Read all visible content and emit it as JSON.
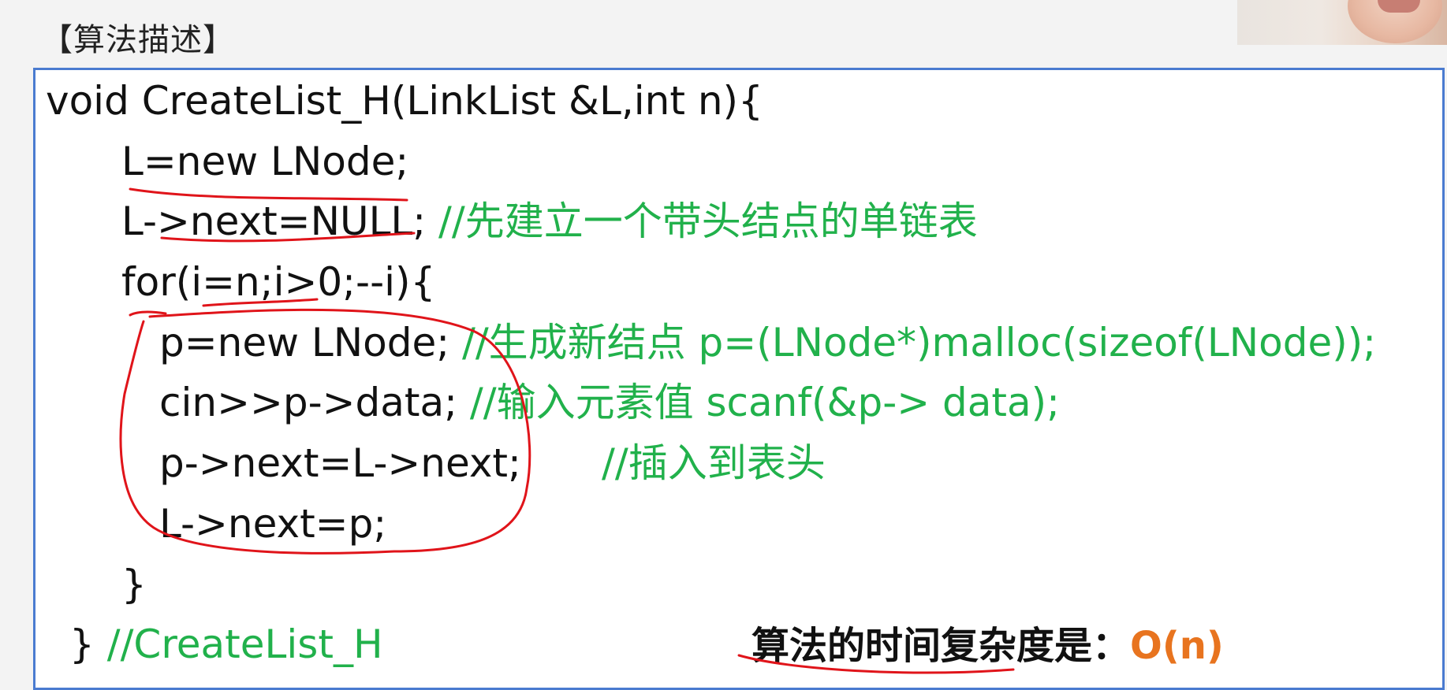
{
  "heading": "【算法描述】",
  "code": {
    "l1": "void CreateList_H(LinkList &L,int n){",
    "l2": "L=new LNode;",
    "l3_code": "L->next=NULL;",
    "l3_comment": " //先建立一个带头结点的单链表",
    "l4": "for(i=n;i>0;--i){",
    "l5_code": "p=new LNode;",
    "l5_comment": " //生成新结点 p=(LNode*)malloc(sizeof(LNode));",
    "l6_code": "cin>>p->data;",
    "l6_comment": " //输入元素值 scanf(&p-> data);",
    "l7_code": "p->next=L->next;",
    "l7_comment": "//插入到表头",
    "l8": "L->next=p;",
    "l9": "}",
    "l10_code": "} ",
    "l10_comment": "//CreateList_H"
  },
  "complexity": {
    "label": "算法的时间复杂度是：",
    "value": "O(n)"
  },
  "colors": {
    "comment": "#21b14b",
    "frame": "#4a7bd0",
    "complexity_value": "#e8741f",
    "annotation": "#e0141a"
  }
}
